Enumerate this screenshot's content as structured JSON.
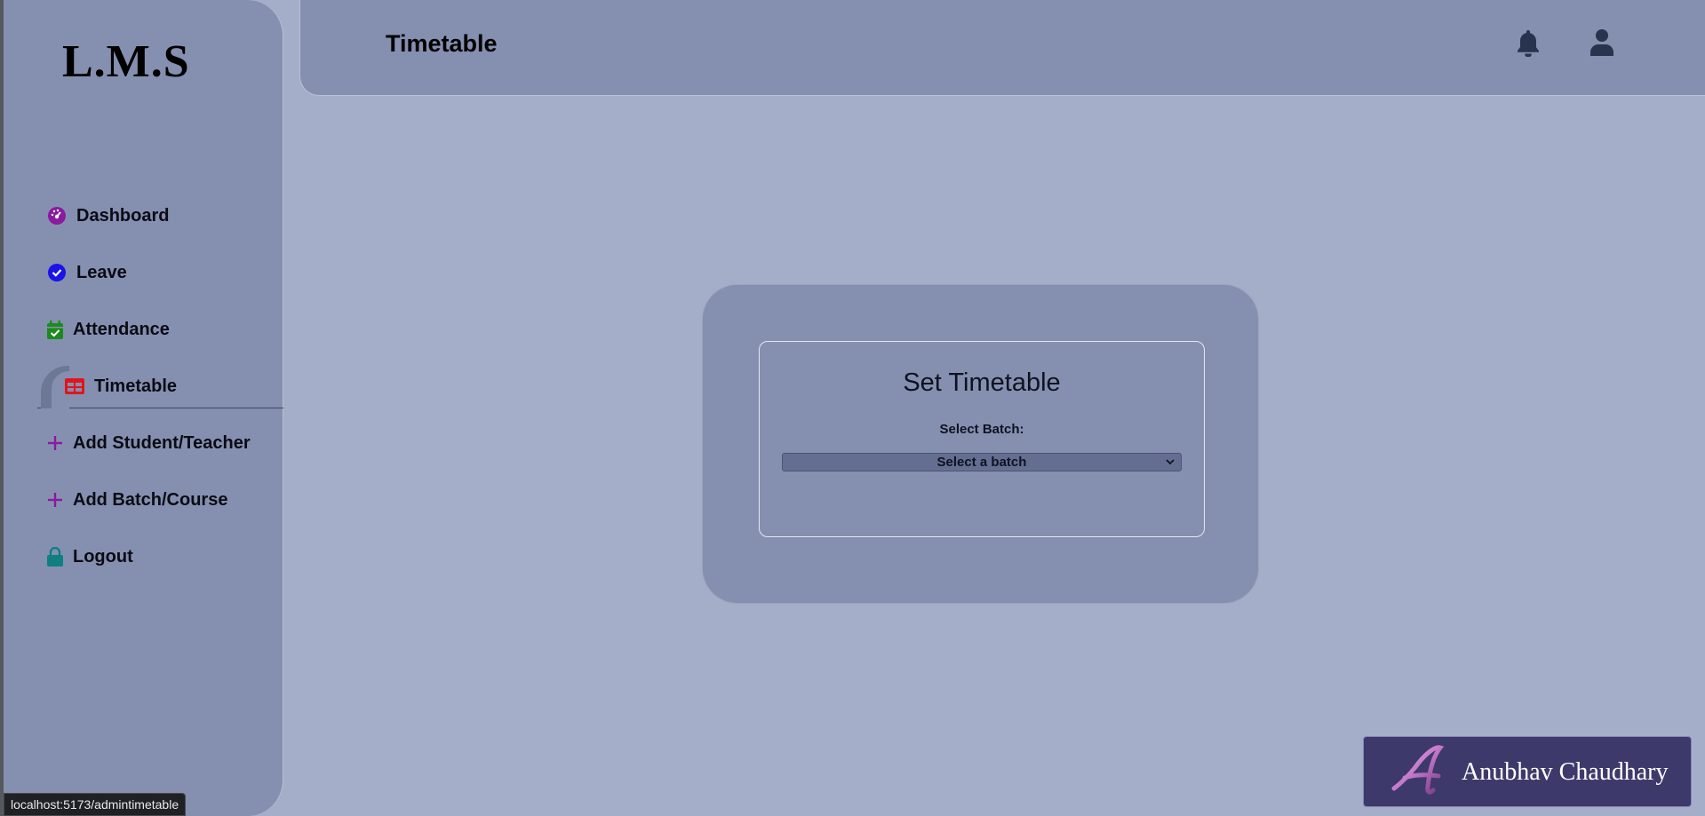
{
  "app": {
    "logo": "L.M.S"
  },
  "sidebar": {
    "items": [
      {
        "label": "Dashboard",
        "icon": "dashboard-gauge-icon",
        "icon_color": "#8a1a9e"
      },
      {
        "label": "Leave",
        "icon": "check-circle-icon",
        "icon_color": "#1a12e6"
      },
      {
        "label": "Attendance",
        "icon": "calendar-check-icon",
        "icon_color": "#1c8a1c"
      },
      {
        "label": "Timetable",
        "icon": "table-icon",
        "icon_color": "#e0151b",
        "active": true
      },
      {
        "label": "Add Student/Teacher",
        "icon": "plus-icon",
        "icon_color": "#8a1a9e"
      },
      {
        "label": "Add Batch/Course",
        "icon": "plus-icon",
        "icon_color": "#8a1a9e"
      },
      {
        "label": "Logout",
        "icon": "lock-icon",
        "icon_color": "#0f7f7f"
      }
    ]
  },
  "header": {
    "title": "Timetable",
    "icons": [
      "bell-icon",
      "user-icon"
    ]
  },
  "main": {
    "card_title": "Set Timetable",
    "select_label": "Select Batch:",
    "select_value": "Select a batch"
  },
  "watermark": {
    "name": "Anubhav Chaudhary"
  },
  "status_bar": {
    "url": "localhost:5173/admintimetable"
  },
  "colors": {
    "background": "#a4aec9",
    "panel": "#8590b0",
    "select_bg": "#646e90",
    "watermark_bg": "#3d3a6b"
  }
}
